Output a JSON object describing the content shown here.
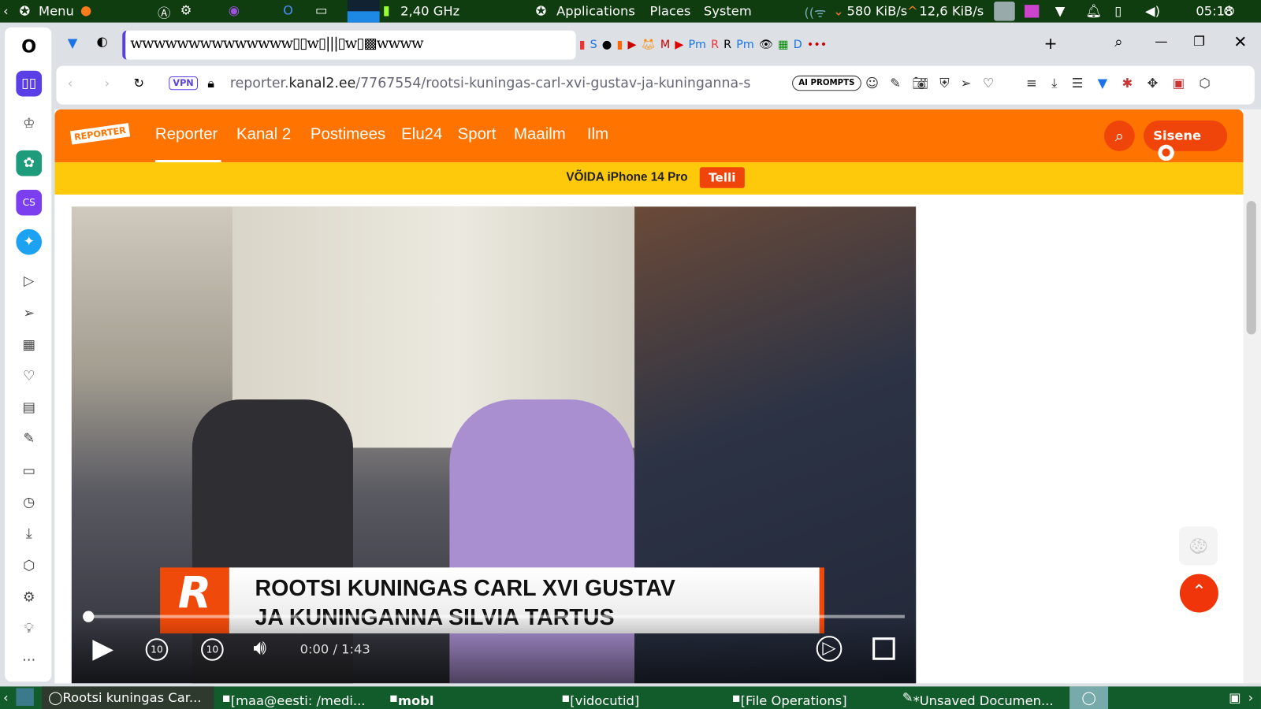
{
  "topbar": {
    "menu": "Menu",
    "cpu": "2,40 GHz",
    "applications": "Applications",
    "places": "Places",
    "system": "System",
    "down": "580 KiB/s",
    "up": "12,6 KiB/s",
    "time": "05:18"
  },
  "browser": {
    "url_host_pre": "reporter.",
    "url_host": "kanal2.ee",
    "url_path": "/7767554/rootsi-kuningas-carl-xvi-gustav-ja-kuninganna-s",
    "vpn": "VPN",
    "ai_prompts": "AI PROMPTS"
  },
  "site": {
    "logo": "REPORTER",
    "nav": [
      "Reporter",
      "Kanal 2",
      "Postimees",
      "Elu24",
      "Sport",
      "Maailm",
      "Ilm"
    ],
    "login": "Sisene",
    "promo": "VÕIDA iPhone 14 Pro",
    "promo_button": "Telli"
  },
  "video": {
    "headline_1": "ROOTSI KUNINGAS CARL XVI GUSTAV",
    "headline_2": "JA KUNINGANNA SILVIA TARTUS",
    "time": "0:00 / 1:43",
    "progress": 0,
    "skip_back": "10",
    "skip_fwd": "10"
  },
  "taskbar": {
    "items": [
      "Rootsi kuningas Car...",
      "[maa@eesti: /medi...",
      "mobl",
      "[vidocutid]",
      "[File Operations]",
      "*Unsaved Documen..."
    ]
  }
}
